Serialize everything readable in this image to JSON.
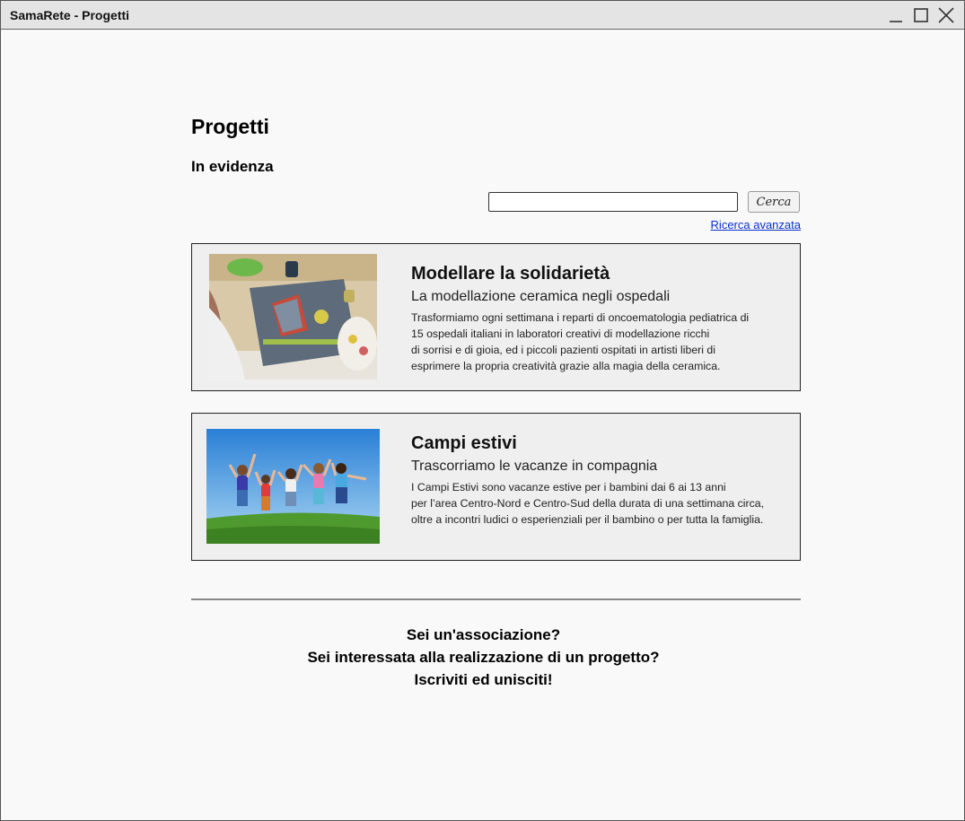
{
  "window": {
    "title": "SamaRete - Progetti"
  },
  "page": {
    "title": "Progetti",
    "subtitle": "In evidenza"
  },
  "search": {
    "placeholder": "",
    "value": "",
    "button_label": "Cerca",
    "advanced_link": "Ricerca avanzata"
  },
  "projects": [
    {
      "title": "Modellare la solidarietà",
      "subtitle": "La modellazione ceramica negli ospedali",
      "description": [
        "Trasformiamo ogni settimana i reparti di oncoematologia pediatrica di",
        "15 ospedali italiani in laboratori creativi di modellazione ricchi",
        "di sorrisi e di gioia, ed i piccoli pazienti ospitati in artisti liberi di",
        "esprimere la propria creatività grazie alla magia della ceramica."
      ],
      "image": "ceramic-workshop-photo"
    },
    {
      "title": "Campi estivi",
      "subtitle": "Trascorriamo le vacanze in compagnia",
      "description": [
        "I Campi Estivi sono vacanze estive per i bambini dai 6 ai 13 anni",
        "per l’area Centro-Nord e Centro-Sud della durata di una settimana circa,",
        "oltre a incontri ludici o esperienziali per il bambino o per tutta la famiglia."
      ],
      "image": "children-jumping-photo"
    }
  ],
  "cta": {
    "line1": "Sei un'associazione?",
    "line2": "Sei interessata alla realizzazione di un progetto?",
    "line3": "Iscriviti ed unisciti!"
  },
  "icons": {
    "minimize": "minimize-icon",
    "maximize": "maximize-icon",
    "close": "close-icon"
  }
}
